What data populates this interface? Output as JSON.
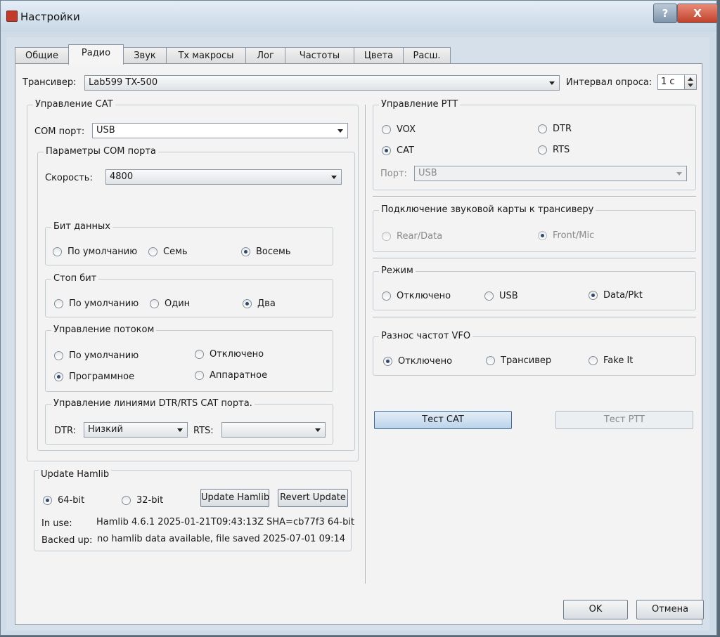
{
  "window": {
    "title": "Настройки",
    "help": "?",
    "close": "X"
  },
  "tabs": [
    "Общие",
    "Радио",
    "Звук",
    "Tx макросы",
    "Лог",
    "Частоты",
    "Цвета",
    "Расш."
  ],
  "transceiver": {
    "label": "Трансивер:",
    "value": "Lab599 TX-500",
    "poll_label": "Интервал опроса:",
    "poll_value": "1 с"
  },
  "cat": {
    "title": "Управление CAT",
    "com_label": "COM порт:",
    "com_value": "USB",
    "params": {
      "title": "Параметры COM порта",
      "speed_label": "Скорость:",
      "speed_value": "4800",
      "data_bits": {
        "title": "Бит данных",
        "options": [
          "По умолчанию",
          "Семь",
          "Восемь"
        ],
        "selected": "Восемь"
      },
      "stop_bits": {
        "title": "Стоп бит",
        "options": [
          "По умолчанию",
          "Один",
          "Два"
        ],
        "selected": "Два"
      },
      "flow": {
        "title": "Управление потоком",
        "options": [
          "По умолчанию",
          "Отключено",
          "Программное",
          "Аппаратное"
        ],
        "selected": "Программное"
      },
      "lines": {
        "title": "Управление линиями DTR/RTS CAT порта.",
        "dtr_label": "DTR:",
        "dtr_value": "Низкий",
        "rts_label": "RTS:",
        "rts_value": ""
      }
    }
  },
  "hamlib": {
    "title": "Update Hamlib",
    "options": [
      "64-bit",
      "32-bit"
    ],
    "selected": "64-bit",
    "update_btn": "Update Hamlib",
    "revert_btn": "Revert Update",
    "inuse_label": "In use:",
    "inuse_value": "Hamlib 4.6.1 2025-01-21T09:43:13Z SHA=cb77f3 64-bit",
    "backed_label": "Backed up:",
    "backed_value": "no hamlib data available, file saved 2025-07-01 09:14"
  },
  "ptt": {
    "title": "Управление PTT",
    "options": [
      "VOX",
      "DTR",
      "CAT",
      "RTS"
    ],
    "selected": "CAT",
    "port_label": "Порт:",
    "port_value": "USB"
  },
  "soundcard": {
    "title": "Подключение звуковой карты к трансиверу",
    "options": [
      "Rear/Data",
      "Front/Mic"
    ],
    "selected": "Front/Mic"
  },
  "mode": {
    "title": "Режим",
    "options": [
      "Отключено",
      "USB",
      "Data/Pkt"
    ],
    "selected": "Data/Pkt"
  },
  "split": {
    "title": "Разнос частот VFO",
    "options": [
      "Отключено",
      "Трансивер",
      "Fake It"
    ],
    "selected": "Отключено"
  },
  "buttons": {
    "test_cat": "Тест CAT",
    "test_ptt": "Тест PTT",
    "ok": "OK",
    "cancel": "Отмена"
  }
}
